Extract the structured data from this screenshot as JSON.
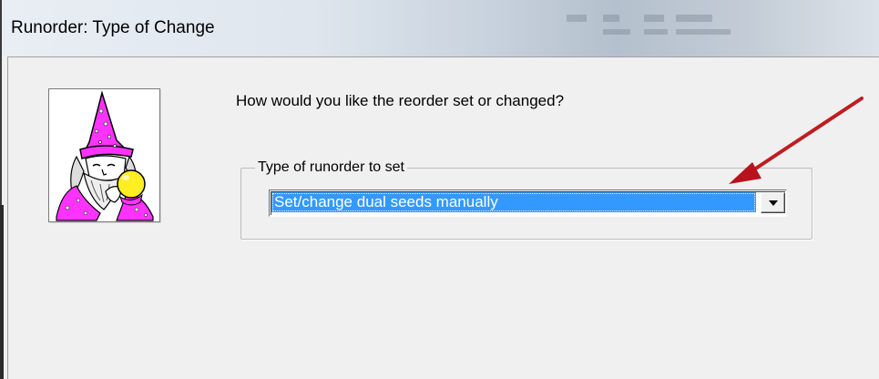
{
  "window": {
    "title": "Runorder: Type of Change"
  },
  "question": "How would you like the reorder set or changed?",
  "group": {
    "legend": "Type of runorder to set",
    "combo": {
      "selected": "Set/change dual seeds manually"
    }
  },
  "icons": {
    "wizard": "wizard-illustration",
    "dropdown": "chevron-down-icon",
    "annotation": "red-arrow-annotation"
  },
  "colors": {
    "selection": "#3399ff",
    "annotation_arrow": "#c0161c",
    "wizard_hat": "#ff33ff",
    "crystal_ball": "#ffee22"
  }
}
